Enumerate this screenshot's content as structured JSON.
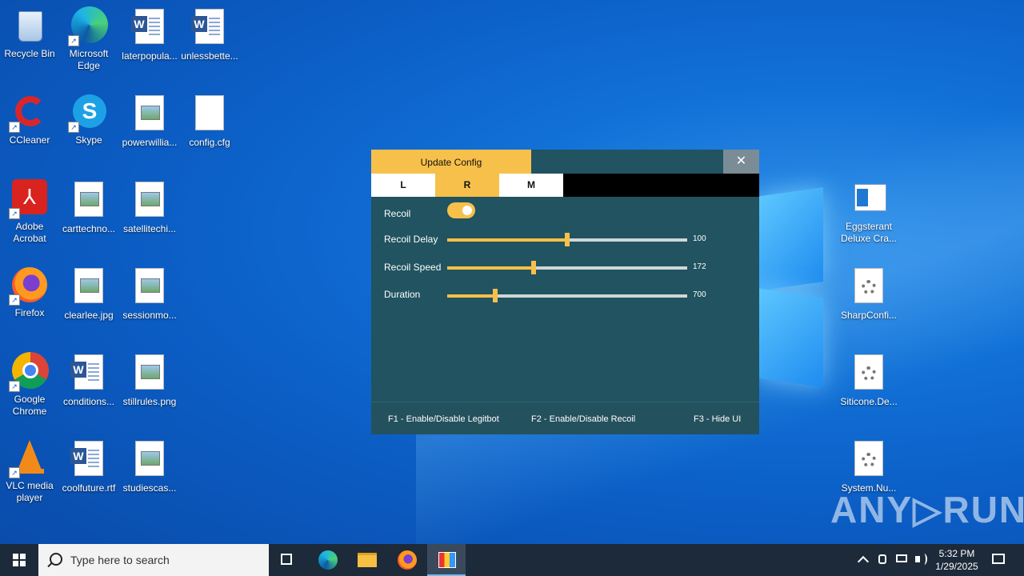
{
  "desktop_icons": [
    {
      "label": "Recycle Bin",
      "kind": "recycle"
    },
    {
      "label": "Microsoft Edge",
      "kind": "edge"
    },
    {
      "label": "laterpopula...",
      "kind": "word"
    },
    {
      "label": "unlessbette...",
      "kind": "word"
    },
    {
      "label": "CCleaner",
      "kind": "ccleaner"
    },
    {
      "label": "Skype",
      "kind": "skype"
    },
    {
      "label": "powerwillia...",
      "kind": "image"
    },
    {
      "label": "config.cfg",
      "kind": "blank"
    },
    {
      "label": "Adobe Acrobat",
      "kind": "acrobat"
    },
    {
      "label": "carttechno...",
      "kind": "image"
    },
    {
      "label": "satellitechi...",
      "kind": "image"
    },
    {
      "label": "Firefox",
      "kind": "firefox"
    },
    {
      "label": "clearlee.jpg",
      "kind": "image"
    },
    {
      "label": "sessionmo...",
      "kind": "image"
    },
    {
      "label": "Google Chrome",
      "kind": "chrome"
    },
    {
      "label": "conditions...",
      "kind": "word"
    },
    {
      "label": "stillrules.png",
      "kind": "image"
    },
    {
      "label": "VLC media player",
      "kind": "vlc"
    },
    {
      "label": "coolfuture.rtf",
      "kind": "word"
    },
    {
      "label": "studiescas...",
      "kind": "image"
    },
    {
      "label": "Eggsterant Deluxe Cra...",
      "kind": "app"
    },
    {
      "label": "SharpConfi...",
      "kind": "gear"
    },
    {
      "label": "Siticone.De...",
      "kind": "gear"
    },
    {
      "label": "System.Nu...",
      "kind": "gear"
    }
  ],
  "app": {
    "title": "Update Config",
    "close_glyph": "✕",
    "tabs": [
      "L",
      "R",
      "M"
    ],
    "active_tab": "R",
    "recoil_label": "Recoil",
    "recoil_enabled": true,
    "sliders": [
      {
        "label": "Recoil Delay",
        "value": "100",
        "fraction": 0.5
      },
      {
        "label": "Recoil Speed",
        "value": "172",
        "fraction": 0.36
      },
      {
        "label": "Duration",
        "value": "700",
        "fraction": 0.2
      }
    ],
    "footer": {
      "f1": "F1 - Enable/Disable Legitbot",
      "f2": "F2 - Enable/Disable Recoil",
      "f3": "F3 - Hide UI"
    },
    "colors": {
      "accent": "#f7c04a",
      "panel": "#215360"
    }
  },
  "taskbar": {
    "search_placeholder": "Type here to search",
    "time": "5:32 PM",
    "date": "1/29/2025"
  },
  "watermark": "ANY▷RUN"
}
